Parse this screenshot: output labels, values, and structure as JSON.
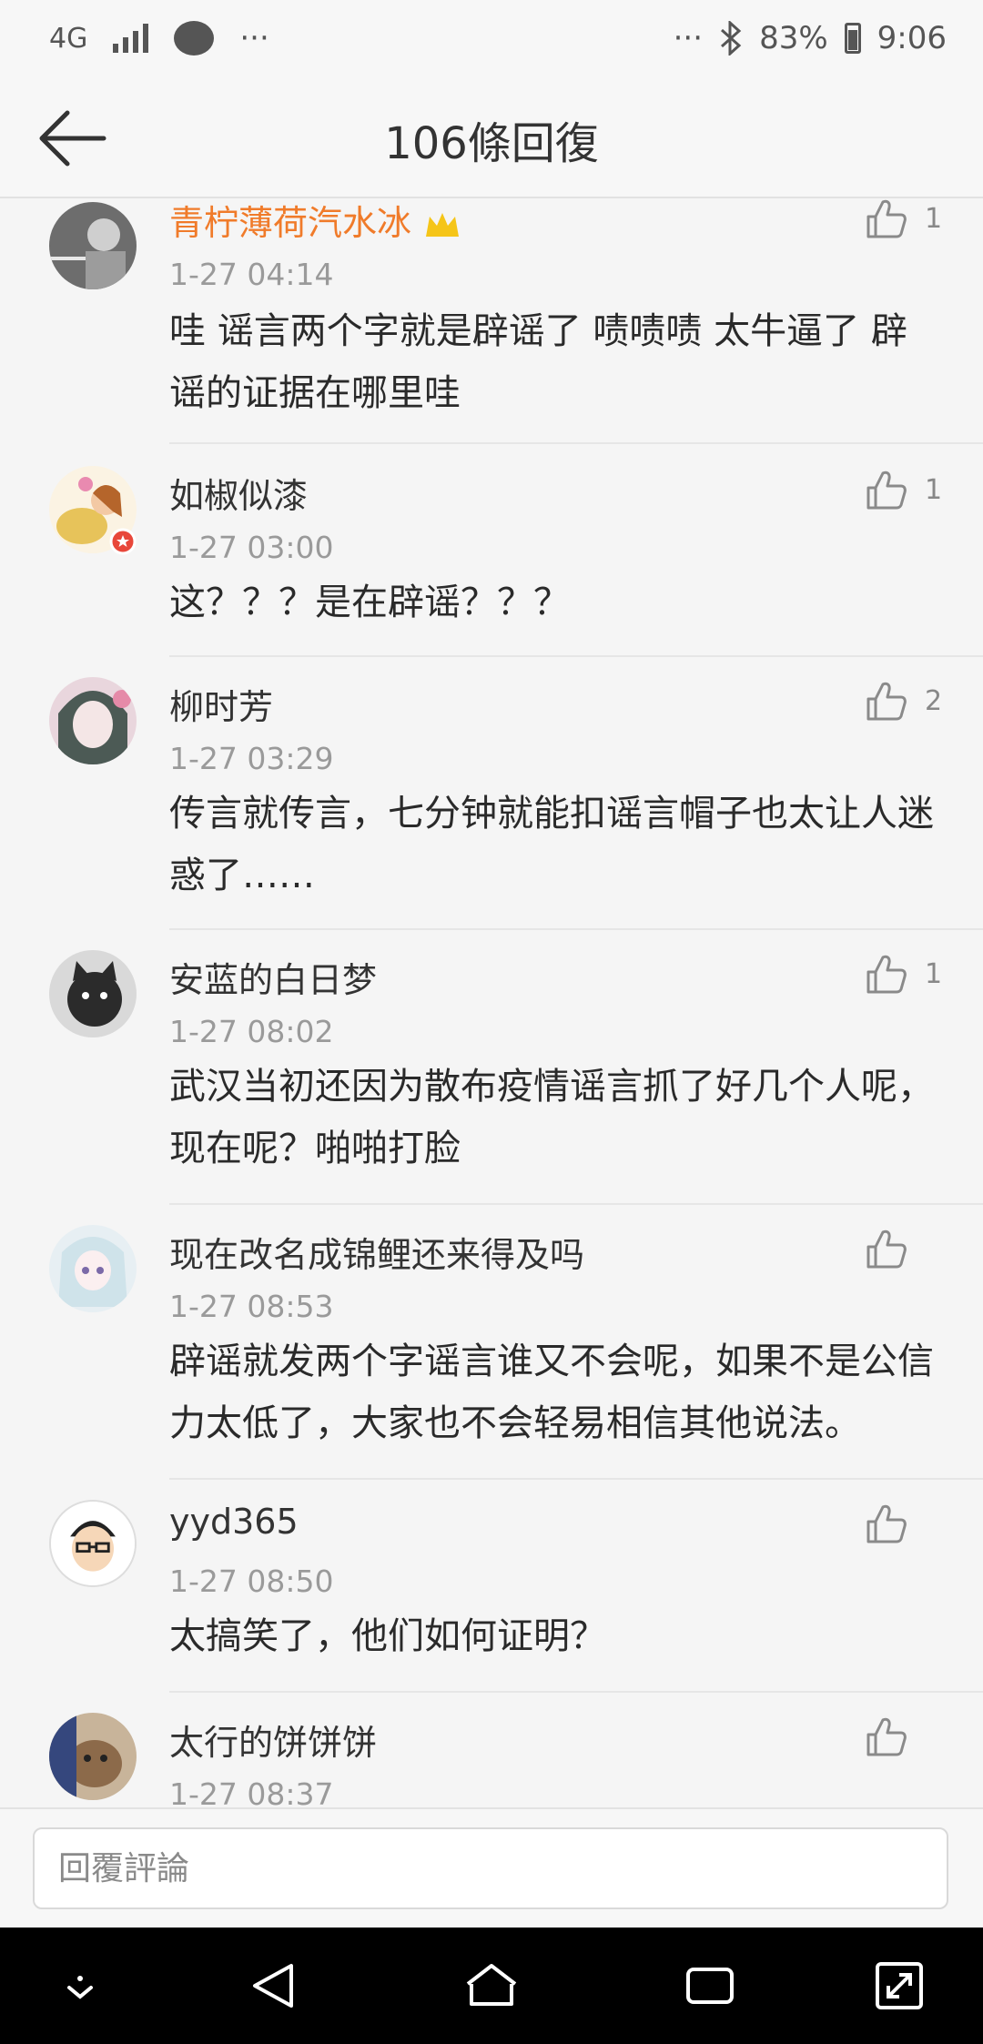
{
  "status_bar": {
    "network": "4G",
    "dots_left": "···",
    "dots_right": "···",
    "battery_percent": "83%",
    "time": "9:06"
  },
  "header": {
    "title": "106條回復",
    "back_icon": "arrow-left-icon"
  },
  "comments": [
    {
      "author": "青柠薄荷汽水冰",
      "time": "1-27 04:14",
      "text": "哇 谣言两个字就是辟谣了 啧啧啧 太牛逼了 辟谣的证据在哪里哇",
      "likes": "1"
    },
    {
      "author": "如椒似漆",
      "time": "1-27 03:00",
      "text": "这？？？是在辟谣？？？",
      "likes": "1"
    },
    {
      "author": "柳时芳",
      "time": "1-27 03:29",
      "text": "传言就传言，七分钟就能扣谣言帽子也太让人迷惑了……",
      "likes": "2"
    },
    {
      "author": "安蓝的白日梦",
      "time": "1-27 08:02",
      "text": "武汉当初还因为散布疫情谣言抓了好几个人呢，现在呢？啪啪打脸",
      "likes": "1"
    },
    {
      "author": "现在改名成锦鲤还来得及吗",
      "time": "1-27 08:53",
      "text": "辟谣就发两个字谣言谁又不会呢，如果不是公信力太低了，大家也不会轻易相信其他说法。",
      "likes": ""
    },
    {
      "author": "yyd365",
      "time": "1-27 08:50",
      "text": "太搞笑了，他们如何证明？",
      "likes": ""
    },
    {
      "author": "太行的饼饼饼",
      "time": "1-27 08:37",
      "text": "",
      "likes": ""
    }
  ],
  "reply": {
    "placeholder": "回覆評論"
  },
  "colors": {
    "accent_orange": "#f07b2a",
    "muted_text": "#9a9a9a",
    "nav_bar": "#000000"
  }
}
